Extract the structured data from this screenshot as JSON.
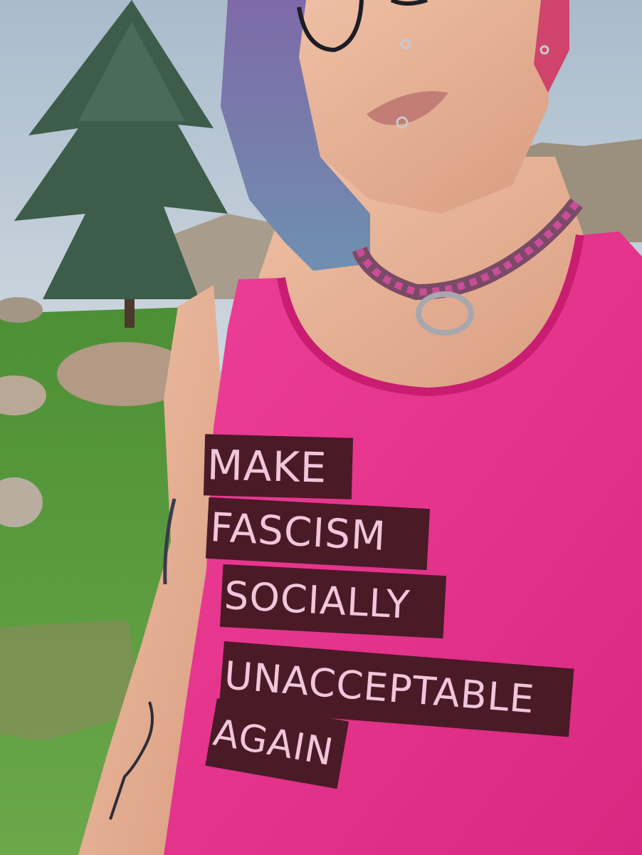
{
  "shirt": {
    "slogan_lines": [
      "MAKE",
      "FASCISM",
      "SOCIALLY",
      "UNACCEPTABLE",
      "AGAIN"
    ],
    "colors": {
      "shirt": "#e6348f",
      "print_block": "#4a1a27",
      "print_text": "#f1c6da"
    }
  },
  "scene_colors": {
    "sky": "#b9c6d2",
    "grass": "#5aa43a",
    "hair": "#8a8fbf",
    "skin": "#e9b497"
  }
}
